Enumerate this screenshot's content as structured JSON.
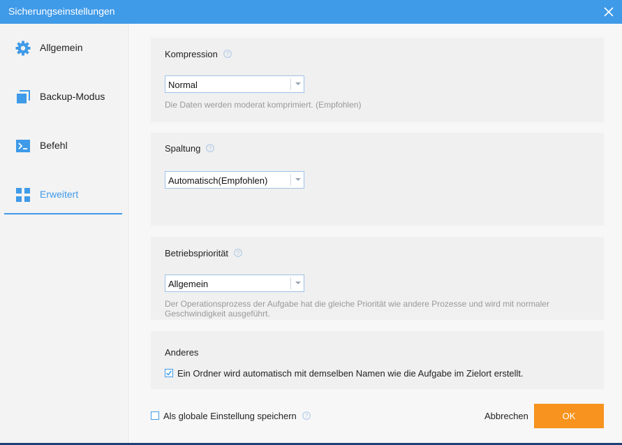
{
  "window": {
    "title": "Sicherungseinstellungen",
    "close_icon": "close-icon",
    "accent_color": "#3f9ae8"
  },
  "sidebar": {
    "items": [
      {
        "label": "Allgemein",
        "icon": "gear-icon",
        "active": false
      },
      {
        "label": "Backup-Modus",
        "icon": "copy-icon",
        "active": false
      },
      {
        "label": "Befehl",
        "icon": "terminal-icon",
        "active": false
      },
      {
        "label": "Erweitert",
        "icon": "grid-icon",
        "active": true
      }
    ]
  },
  "sections": {
    "compression": {
      "title": "Kompression",
      "selected": "Normal",
      "description": "Die Daten werden moderat komprimiert. (Empfohlen)"
    },
    "splitting": {
      "title": "Spaltung",
      "selected": "Automatisch(Empfohlen)"
    },
    "priority": {
      "title": "Betriebspriorität",
      "selected": "Allgemein",
      "description_line1": "Der Operationsprozess der Aufgabe hat die gleiche Priorität wie andere Prozesse und wird mit normaler",
      "description_line2": "Geschwindigkeit ausgeführt."
    },
    "other": {
      "title": "Anderes",
      "checkbox_label": "Ein Ordner wird automatisch mit demselben Namen wie die Aufgabe im Zielort erstellt.",
      "checked": true
    }
  },
  "footer": {
    "global_checkbox_label": "Als globale Einstellung speichern",
    "global_checked": false,
    "cancel_label": "Abbrechen",
    "ok_label": "OK",
    "ok_color": "#f7931e"
  }
}
